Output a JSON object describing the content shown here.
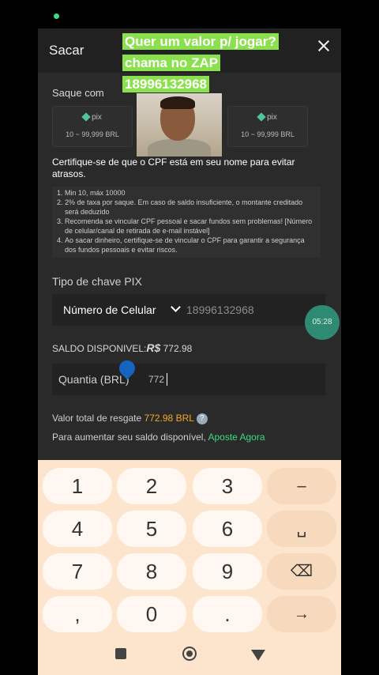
{
  "header": {
    "title": "Sacar"
  },
  "overlay": {
    "zap_text": "Quer um valor p/ jogar? chama no ZAP 18996132968"
  },
  "saque": {
    "label": "Saque com",
    "cards": [
      {
        "logo": "pix",
        "range": "10 ~ 99,999 BRL"
      },
      {
        "logo": "pix",
        "range": "10 ~ 99,999 BRL"
      }
    ]
  },
  "notice": "Certifique-se de que o CPF está em seu nome para evitar atrasos.",
  "rules": [
    "Min 10, máx 10000",
    "2% de taxa por saque. Em caso de saldo insuficiente, o montante creditado será deduzido",
    "Recomenda se vincular CPF pessoal e sacar fundos sem problemas! [Número de celular/canal de retirada de e-mail instável]",
    "Ao sacar dinheiro, certifique-se de vincular o CPF para garantir a segurança dos fundos pessoais e evitar riscos."
  ],
  "pix": {
    "label": "Tipo de chave PIX",
    "selected": "Número de Celular",
    "value": "18996132968"
  },
  "timer": "05:28",
  "saldo": {
    "label": "SALDO DISPONIVEL:",
    "currency": "R$",
    "value": "772.98"
  },
  "amount": {
    "label": "Quantia (BRL)",
    "value": "772"
  },
  "total": {
    "label": "Valor total de resgate",
    "value": "772.98 BRL",
    "help": "?"
  },
  "aumentar": {
    "text": "Para aumentar seu saldo disponível,",
    "link": "Aposte Agora"
  },
  "keyboard": {
    "keys": [
      "1",
      "2",
      "3",
      "–",
      "4",
      "5",
      "6",
      "␣",
      "7",
      "8",
      "9",
      "⌫",
      ",",
      "0",
      ".",
      "→"
    ]
  },
  "colors": {
    "accent_green": "#3ddc84",
    "amount_orange": "#f5a623",
    "zap_green": "#8be04e"
  }
}
